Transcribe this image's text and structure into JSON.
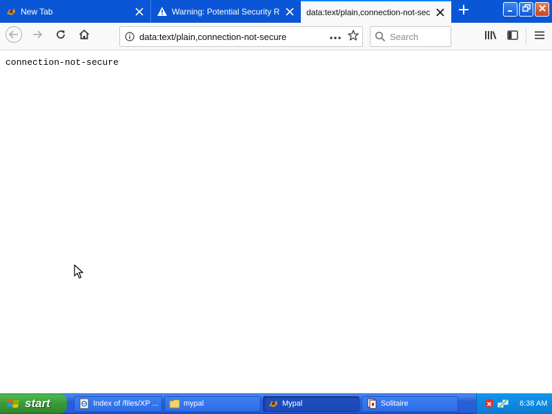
{
  "tabs": [
    {
      "title": "New Tab",
      "favicon": "mypal-icon"
    },
    {
      "title": "Warning: Potential Security Risk Ahead",
      "favicon": "warning-icon"
    },
    {
      "title": "data:text/plain,connection-not-secure",
      "favicon": "none",
      "selected": true
    }
  ],
  "navbar": {
    "url": "data:text/plain,connection-not-secure",
    "search_placeholder": "Search"
  },
  "content": {
    "text": "connection-not-secure"
  },
  "taskbar": {
    "start_label": "start",
    "items": [
      {
        "label": "Index of /files/XP ...",
        "icon": "ie-page-icon"
      },
      {
        "label": "mypal",
        "icon": "folder-icon"
      },
      {
        "label": "Mypal",
        "icon": "mypal-icon",
        "active": true
      },
      {
        "label": "Solitaire",
        "icon": "solitaire-icon"
      }
    ],
    "clock": "6:38 AM"
  },
  "colors": {
    "tabstrip": "#0b56d6",
    "taskbar": "#245edb",
    "start": "#3a9a3a",
    "tray": "#0e89e0"
  }
}
